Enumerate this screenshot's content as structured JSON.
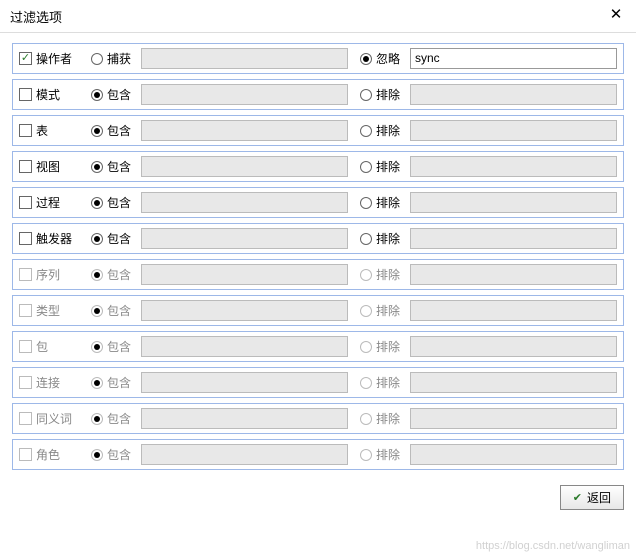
{
  "title": "过滤选项",
  "close_label": "✕",
  "labels": {
    "capture": "捕获",
    "ignore": "忽略",
    "include": "包含",
    "exclude": "排除"
  },
  "rows": [
    {
      "key": "operator",
      "label": "操作者",
      "enabled": true,
      "checked": true,
      "mode": "ignore",
      "capture_val": "",
      "ignore_val": "sync",
      "opt1": "capture",
      "opt2": "ignore"
    },
    {
      "key": "schema",
      "label": "模式",
      "enabled": true,
      "checked": false,
      "mode": "include",
      "capture_val": "",
      "ignore_val": "",
      "opt1": "include",
      "opt2": "exclude"
    },
    {
      "key": "table",
      "label": "表",
      "enabled": true,
      "checked": false,
      "mode": "include",
      "capture_val": "",
      "ignore_val": "",
      "opt1": "include",
      "opt2": "exclude"
    },
    {
      "key": "view",
      "label": "视图",
      "enabled": true,
      "checked": false,
      "mode": "include",
      "capture_val": "",
      "ignore_val": "",
      "opt1": "include",
      "opt2": "exclude"
    },
    {
      "key": "procedure",
      "label": "过程",
      "enabled": true,
      "checked": false,
      "mode": "include",
      "capture_val": "",
      "ignore_val": "",
      "opt1": "include",
      "opt2": "exclude"
    },
    {
      "key": "trigger",
      "label": "触发器",
      "enabled": true,
      "checked": false,
      "mode": "include",
      "capture_val": "",
      "ignore_val": "",
      "opt1": "include",
      "opt2": "exclude"
    },
    {
      "key": "sequence",
      "label": "序列",
      "enabled": false,
      "checked": false,
      "mode": "include",
      "capture_val": "",
      "ignore_val": "",
      "opt1": "include",
      "opt2": "exclude"
    },
    {
      "key": "type",
      "label": "类型",
      "enabled": false,
      "checked": false,
      "mode": "include",
      "capture_val": "",
      "ignore_val": "",
      "opt1": "include",
      "opt2": "exclude"
    },
    {
      "key": "package",
      "label": "包",
      "enabled": false,
      "checked": false,
      "mode": "include",
      "capture_val": "",
      "ignore_val": "",
      "opt1": "include",
      "opt2": "exclude"
    },
    {
      "key": "connect",
      "label": "连接",
      "enabled": false,
      "checked": false,
      "mode": "include",
      "capture_val": "",
      "ignore_val": "",
      "opt1": "include",
      "opt2": "exclude"
    },
    {
      "key": "synonym",
      "label": "同义词",
      "enabled": false,
      "checked": false,
      "mode": "include",
      "capture_val": "",
      "ignore_val": "",
      "opt1": "include",
      "opt2": "exclude"
    },
    {
      "key": "role",
      "label": "角色",
      "enabled": false,
      "checked": false,
      "mode": "include",
      "capture_val": "",
      "ignore_val": "",
      "opt1": "include",
      "opt2": "exclude"
    }
  ],
  "footer": {
    "back_label": "返回"
  },
  "watermark": "https://blog.csdn.net/wangliman"
}
